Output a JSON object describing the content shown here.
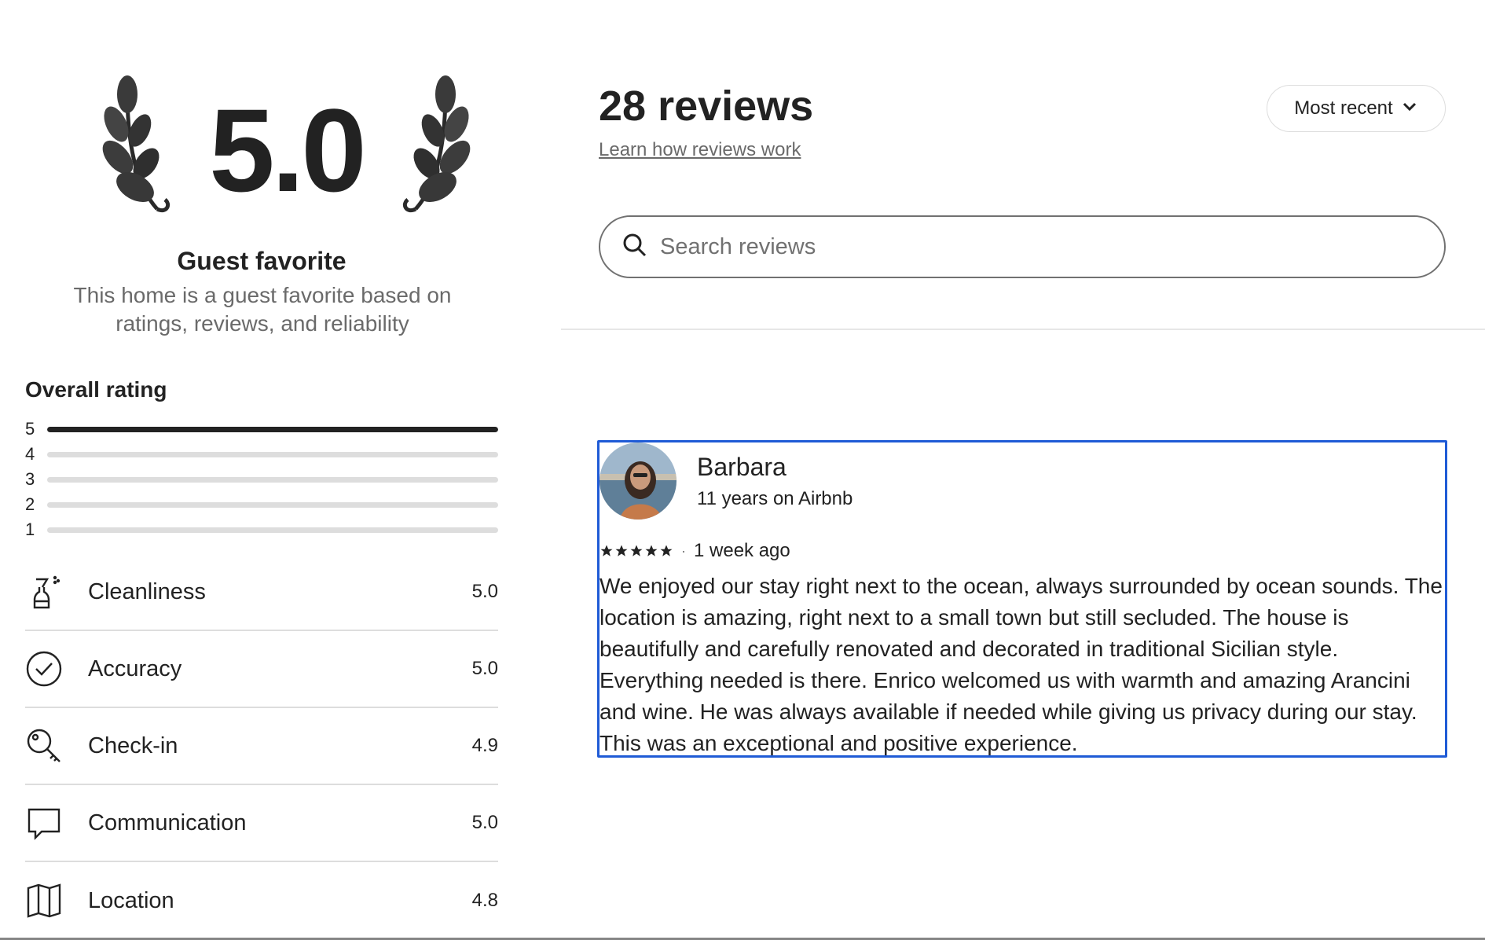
{
  "rating": {
    "score": "5.0",
    "badge_title": "Guest favorite",
    "badge_description": "This home is a guest favorite based on ratings, reviews, and reliability"
  },
  "overall": {
    "label": "Overall rating",
    "distribution": [
      {
        "stars": "5",
        "fraction": 1.0
      },
      {
        "stars": "4",
        "fraction": 0.0
      },
      {
        "stars": "3",
        "fraction": 0.0
      },
      {
        "stars": "2",
        "fraction": 0.0
      },
      {
        "stars": "1",
        "fraction": 0.0
      }
    ]
  },
  "categories": [
    {
      "name": "Cleanliness",
      "value": "5.0",
      "icon": "spray-bottle-icon"
    },
    {
      "name": "Accuracy",
      "value": "5.0",
      "icon": "check-circle-icon"
    },
    {
      "name": "Check-in",
      "value": "4.9",
      "icon": "key-icon"
    },
    {
      "name": "Communication",
      "value": "5.0",
      "icon": "chat-bubble-icon"
    },
    {
      "name": "Location",
      "value": "4.8",
      "icon": "map-icon"
    }
  ],
  "reviews_header": {
    "count_label": "28 reviews",
    "learn_link": "Learn how reviews work",
    "sort_label": "Most recent"
  },
  "search": {
    "placeholder": "Search reviews",
    "value": ""
  },
  "review": {
    "name": "Barbara",
    "tenure": "11 years on Airbnb",
    "stars": 5,
    "date": "1 week ago",
    "text": "We enjoyed our stay right next to the ocean, always surrounded by ocean sounds. The location is amazing, right next to a small town but still secluded. The house is beautifully and carefully renovated and decorated in traditional Sicilian style. Everything needed is there. Enrico welcomed us with warmth and amazing Arancini and wine. He was always available if needed while giving us privacy during our stay. This was an exceptional and positive experience."
  },
  "colors": {
    "text": "#222222",
    "muted": "#6a6a6a",
    "focus_border": "#1f5bd6",
    "bar_track": "#dddddd"
  }
}
